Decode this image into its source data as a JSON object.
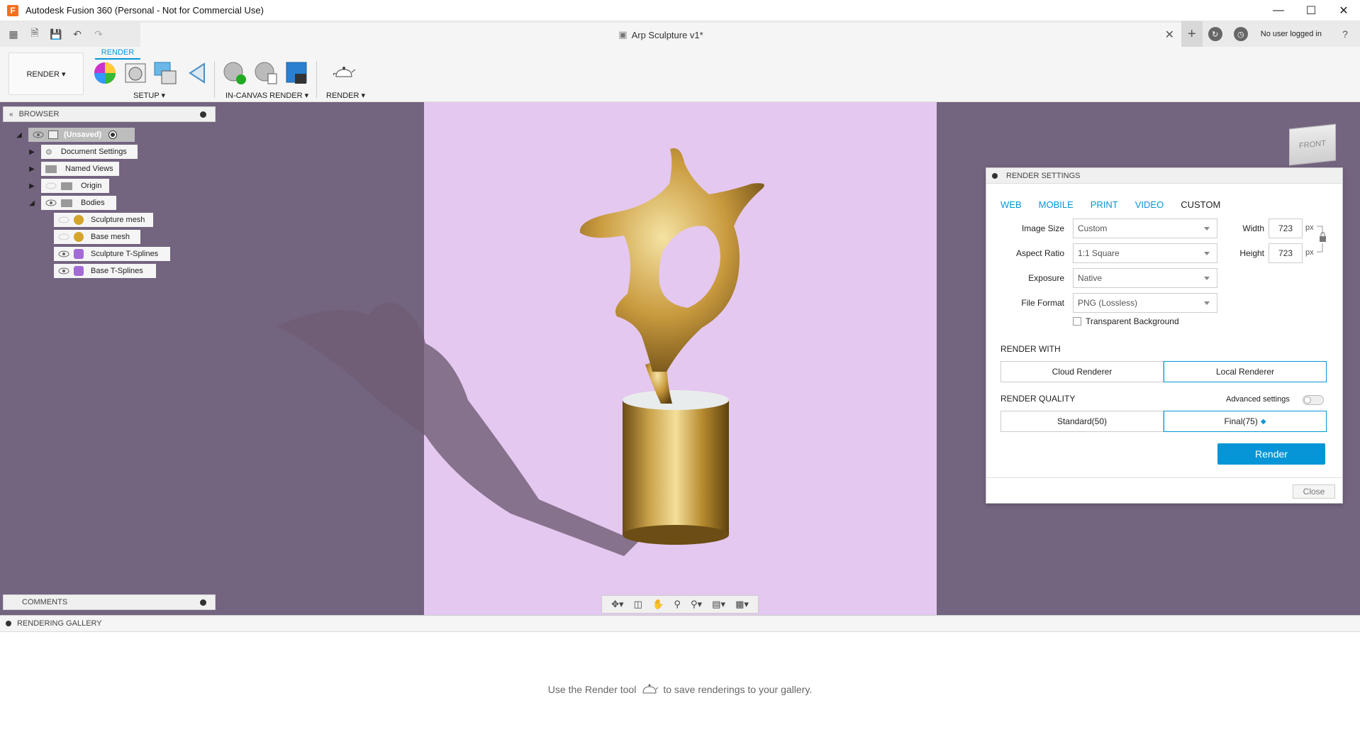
{
  "window": {
    "title": "Autodesk Fusion 360 (Personal - Not for Commercial Use)",
    "app_icon": "F"
  },
  "document_tab": {
    "title": "Arp Sculpture v1*"
  },
  "account": {
    "user": "No user logged in"
  },
  "ribbon": {
    "workspace": "RENDER ▾",
    "tab": "RENDER",
    "groups": {
      "setup": "SETUP ▾",
      "in_canvas": "IN-CANVAS RENDER ▾",
      "render": "RENDER ▾"
    }
  },
  "browser": {
    "title": "BROWSER",
    "root": "(Unsaved)",
    "items": [
      {
        "label": "Document Settings"
      },
      {
        "label": "Named Views"
      },
      {
        "label": "Origin"
      },
      {
        "label": "Bodies"
      }
    ],
    "bodies": [
      {
        "label": "Sculpture mesh"
      },
      {
        "label": "Base mesh"
      },
      {
        "label": "Sculpture T-Splines"
      },
      {
        "label": "Base T-Splines"
      }
    ]
  },
  "comments": {
    "title": "COMMENTS"
  },
  "viewcube": {
    "face": "FRONT"
  },
  "render_settings": {
    "title": "RENDER SETTINGS",
    "tabs": [
      "WEB",
      "MOBILE",
      "PRINT",
      "VIDEO",
      "CUSTOM"
    ],
    "active_tab": "CUSTOM",
    "fields": {
      "image_size": {
        "label": "Image Size",
        "value": "Custom"
      },
      "aspect_ratio": {
        "label": "Aspect Ratio",
        "value": "1:1 Square"
      },
      "exposure": {
        "label": "Exposure",
        "value": "Native"
      },
      "file_format": {
        "label": "File Format",
        "value": "PNG (Lossless)"
      }
    },
    "width": {
      "label": "Width",
      "value": "723",
      "unit": "px"
    },
    "height": {
      "label": "Height",
      "value": "723",
      "unit": "px"
    },
    "transparent_bg": "Transparent Background",
    "render_with": {
      "title": "RENDER WITH",
      "cloud": "Cloud Renderer",
      "local": "Local Renderer",
      "selected": "local"
    },
    "render_quality": {
      "title": "RENDER QUALITY",
      "advanced": "Advanced settings",
      "standard": "Standard(50)",
      "final": "Final(75)",
      "selected": "final"
    },
    "render_button": "Render",
    "close_button": "Close"
  },
  "gallery": {
    "title": "RENDERING GALLERY",
    "msg_before": "Use the Render tool",
    "msg_after": "to save renderings to your gallery."
  },
  "colors": {
    "accent": "#0696d7",
    "viewport_bg": "#736480",
    "render_bg": "#e4c8f0",
    "gold": "#c9a24a"
  }
}
